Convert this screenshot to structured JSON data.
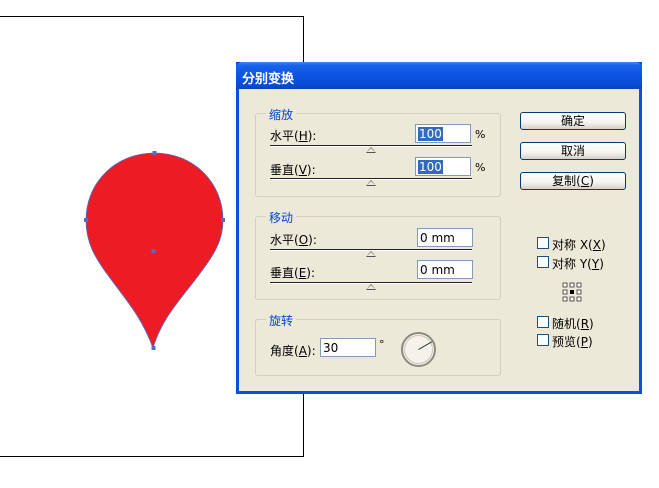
{
  "dialog": {
    "title": "分别变换"
  },
  "scale": {
    "legend": "缩放",
    "horizontal": {
      "label": "水平",
      "mnemonic": "H",
      "value": "100",
      "unit": "%",
      "percent": 100
    },
    "vertical": {
      "label": "垂直",
      "mnemonic": "V",
      "value": "100",
      "unit": "%",
      "percent": 100
    }
  },
  "move": {
    "legend": "移动",
    "horizontal": {
      "label": "水平",
      "mnemonic": "O",
      "value": "0 mm"
    },
    "vertical": {
      "label": "垂直",
      "mnemonic": "E",
      "value": "0 mm"
    }
  },
  "rotate": {
    "legend": "旋转",
    "angle": {
      "label": "角度",
      "mnemonic": "A",
      "value": "30",
      "unit": "°"
    }
  },
  "buttons": {
    "ok": "确定",
    "cancel": "取消",
    "copy": {
      "label": "复制",
      "mnemonic": "C"
    }
  },
  "options": {
    "reflect_x": {
      "label": "对称 X",
      "mnemonic": "X",
      "checked": false
    },
    "reflect_y": {
      "label": "对称 Y",
      "mnemonic": "Y",
      "checked": false
    },
    "random": {
      "label": "随机",
      "mnemonic": "R",
      "checked": false
    },
    "preview": {
      "label": "预览",
      "mnemonic": "P",
      "checked": false
    }
  },
  "colors": {
    "shape_fill": "#ed1c24",
    "anchor": "#4a6fd0",
    "title_bar": "#0a54e3",
    "accent_text": "#0046d5"
  },
  "icons": {
    "dial": "rotation-dial-icon",
    "reference_point": "reference-point-grid-icon"
  }
}
